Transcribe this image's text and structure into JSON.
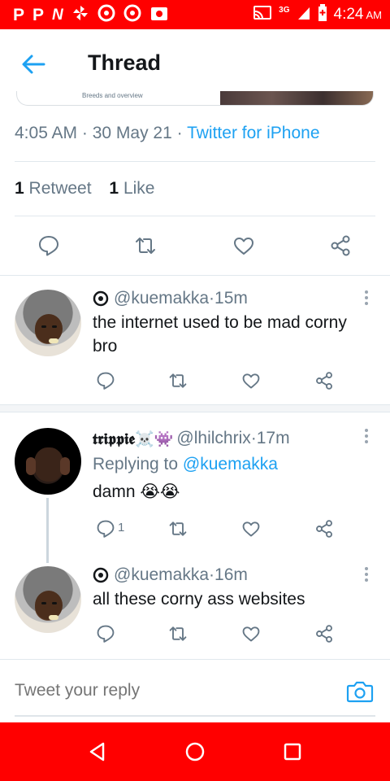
{
  "status_bar": {
    "icons": [
      "pinterest-icon",
      "pinterest-icon",
      "news-icon",
      "pinwheel-icon",
      "chrome-icon",
      "chrome-icon",
      "camera-icon"
    ],
    "glyph_p": "P",
    "glyph_n": "N",
    "network": "3G",
    "time": "4:24",
    "ampm": "AM",
    "color": "#ff0000"
  },
  "header": {
    "title": "Thread",
    "back_icon": "arrow-left-icon"
  },
  "main_tweet": {
    "card_caption": "Breeds and overview",
    "time": "4:05 AM",
    "date": "30 May 21",
    "source": "Twitter for iPhone",
    "retweet_count": "1",
    "retweet_label": "Retweet",
    "like_count": "1",
    "like_label": "Like"
  },
  "replies": [
    {
      "name": "",
      "handle": "@kuemakka",
      "time": "15m",
      "text": "the internet used to be mad corny bro",
      "reply_count": ""
    },
    {
      "name": "𝖙𝖗𝖎𝖕𝖕𝖎𝖊☠️👾",
      "handle": "@lhilchrix",
      "time": "17m",
      "replying_label": "Replying to",
      "replying_to": "@kuemakka",
      "text": "damn 😭😭",
      "reply_count": "1"
    },
    {
      "name": "",
      "handle": "@kuemakka",
      "time": "16m",
      "text": "all these corny ass websites",
      "reply_count": ""
    }
  ],
  "sep": " · ",
  "composer": {
    "placeholder": "Tweet your reply",
    "camera_icon": "camera-icon"
  },
  "nav": {
    "icons": [
      "back-triangle-icon",
      "home-circle-icon",
      "recents-square-icon"
    ]
  },
  "colors": {
    "accent": "#1da1f2",
    "muted": "#657786",
    "text": "#14171a",
    "system_bar": "#ff0000"
  }
}
